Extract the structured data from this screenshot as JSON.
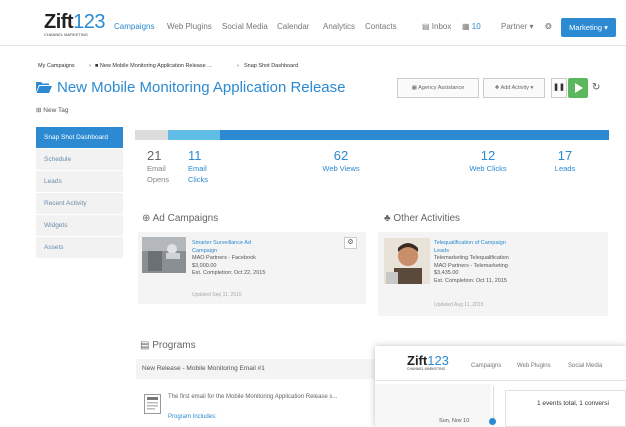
{
  "topnav": {
    "logo_main": "Zift",
    "logo_num": "123",
    "logo_tag": "CHANNEL MARKETING",
    "items": [
      "Campaigns",
      "Web Plugins",
      "Social Media",
      "Calendar",
      "Analytics",
      "Contacts"
    ],
    "inbox": "Inbox",
    "messages_count": "10",
    "partner": "Partner",
    "marketing_button": "Marketing ▾"
  },
  "breadcrumb": {
    "root": "My Campaigns",
    "parent": "New Mobile Monitoring Application Release ...",
    "current": "Snap Shot Dashboard"
  },
  "header": {
    "title": "New Mobile Monitoring Application Release",
    "new_tag": "New Tag",
    "agency_button": "Agency Assistance",
    "add_activity_button": "Add Activity ▾"
  },
  "sidebar": {
    "items": [
      {
        "label": "Snap Shot Dashboard",
        "active": true
      },
      {
        "label": "Schedule",
        "active": false
      },
      {
        "label": "Leads",
        "active": false
      },
      {
        "label": "Recent Activity",
        "active": false
      },
      {
        "label": "Widgets",
        "active": false
      },
      {
        "label": "Assets",
        "active": false
      }
    ]
  },
  "stats": [
    {
      "value": "21",
      "label1": "Email",
      "label2": "Opens"
    },
    {
      "value": "11",
      "label1": "Email",
      "label2": "Clicks"
    },
    {
      "value": "62",
      "label1": "Web Views",
      "label2": ""
    },
    {
      "value": "12",
      "label1": "Web Clicks",
      "label2": ""
    },
    {
      "value": "17",
      "label1": "Leads",
      "label2": ""
    }
  ],
  "ad_campaigns": {
    "title": "Ad Campaigns",
    "card": {
      "name_line1": "Smarter Surveillance Ad",
      "name_line2": "Campaign",
      "line1": "MAO Partners - Facebook",
      "line2": "$3,000.00",
      "line3": "Est. Completion: Oct 22, 2015",
      "footer": "Updated Sep 11, 2015"
    }
  },
  "other_activities": {
    "title": "Other Activities",
    "card": {
      "name_line1": "Telequalification of Campaign",
      "name_line2": "Leads",
      "line1": "Telemarketing Telequalification",
      "line2": "MAO Partners - Telemarketing",
      "line3": "$3,435.00",
      "line4": "Est. Completion: Oct 11, 2015",
      "footer": "Updated Aug 11, 2015"
    }
  },
  "programs": {
    "title": "Programs",
    "row_title": "New Release - Mobile Monitoring Email #1",
    "row_desc": "The first email for the Mobile Monitoring Application Release s...",
    "row_sub": "Program Includes:"
  },
  "overlay": {
    "logo_main": "Zift",
    "logo_num": "123",
    "logo_tag": "CHANNEL MARKETING",
    "nav": [
      "Campaigns",
      "Web Plugins",
      "Social Media"
    ],
    "date": "Sun, Nov 10",
    "summary": "1 events total, 1 conversi"
  },
  "colors": {
    "accent": "#2b8ad1",
    "green": "#5cb85c"
  },
  "progress_segments": [
    {
      "fraction": 0.07,
      "color": "#dcdcdc"
    },
    {
      "fraction": 0.11,
      "color": "#5fbde6"
    },
    {
      "fraction": 0.82,
      "color": "#2b8ad1"
    }
  ]
}
